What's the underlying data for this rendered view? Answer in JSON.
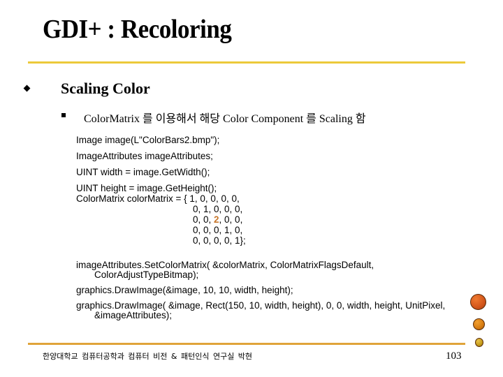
{
  "slide": {
    "title": "GDI+ : Recoloring",
    "bullet_level1": "Scaling Color",
    "bullet_level2": "ColorMatrix 를 이용해서 해당 Color Component 를 Scaling 함",
    "code": {
      "line1": "Image image(L\"ColorBars2.bmp\");",
      "line2": "ImageAttributes imageAttributes;",
      "line3": "UINT width = image.GetWidth();",
      "line4": "UINT height = image.GetHeight();",
      "matrix_decl": "ColorMatrix colorMatrix = { 1, 0, 0, 0, 0,",
      "matrix_row2": "0, 1, 0, 0, 0,",
      "matrix_row3_pre": "0, 0, ",
      "matrix_row3_highlight": "2",
      "matrix_row3_post": ", 0, 0,",
      "matrix_row4": "0, 0, 0, 1, 0,",
      "matrix_row5": "0, 0, 0, 0, 1};",
      "set_matrix_1": "imageAttributes.SetColorMatrix( &colorMatrix, ColorMatrixFlagsDefault,",
      "set_matrix_2": "ColorAdjustTypeBitmap);",
      "draw1": "graphics.DrawImage(&image, 10, 10, width, height);",
      "draw2_1": "graphics.DrawImage( &image, Rect(150, 10, width, height), 0, 0, width, height, UnitPixel,",
      "draw2_2": "&imageAttributes);"
    },
    "highlight_color": "#c8762a",
    "accent_color": "#ecc93a"
  },
  "footer": {
    "text": "한양대학교 컴퓨터공학과  컴퓨터 비전 & 패턴인식 연구실    박현",
    "page_number": "103"
  }
}
